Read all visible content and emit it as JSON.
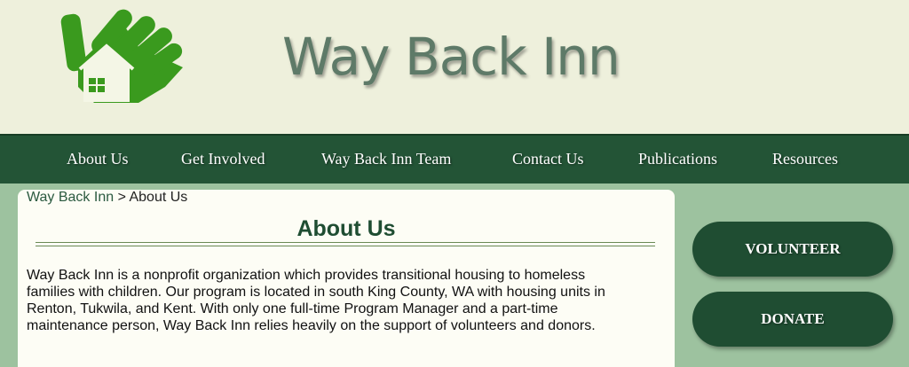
{
  "header": {
    "site_title": "Way Back Inn",
    "logo_icon": "hand-house-logo-icon"
  },
  "nav": {
    "items": [
      {
        "label": "About Us"
      },
      {
        "label": "Get Involved"
      },
      {
        "label": "Way Back Inn Team"
      },
      {
        "label": "Contact Us"
      },
      {
        "label": "Publications"
      },
      {
        "label": "Resources"
      }
    ]
  },
  "breadcrumb": {
    "home": "Way Back Inn",
    "separator": ">",
    "current": "About Us"
  },
  "main": {
    "title": "About Us",
    "paragraph": "Way Back Inn is a nonprofit organization which provides transitional housing to homeless\nfamilies with children. Our program is located in south King County, WA with housing units in\nRenton, Tukwila, and Kent.  With only one full-time Program Manager and a part-time\nmaintenance person, Way Back Inn relies heavily on the support of volunteers and donors."
  },
  "sidebar": {
    "volunteer_label": "VOLUNTEER",
    "donate_label": "DONATE"
  },
  "colors": {
    "header_bg": "#eef0dc",
    "nav_bg": "#235436",
    "page_bg": "#9dc29f",
    "content_bg": "#fdfdf5",
    "logo_green": "#3a9a1e",
    "button_bg": "#1f4d32"
  }
}
